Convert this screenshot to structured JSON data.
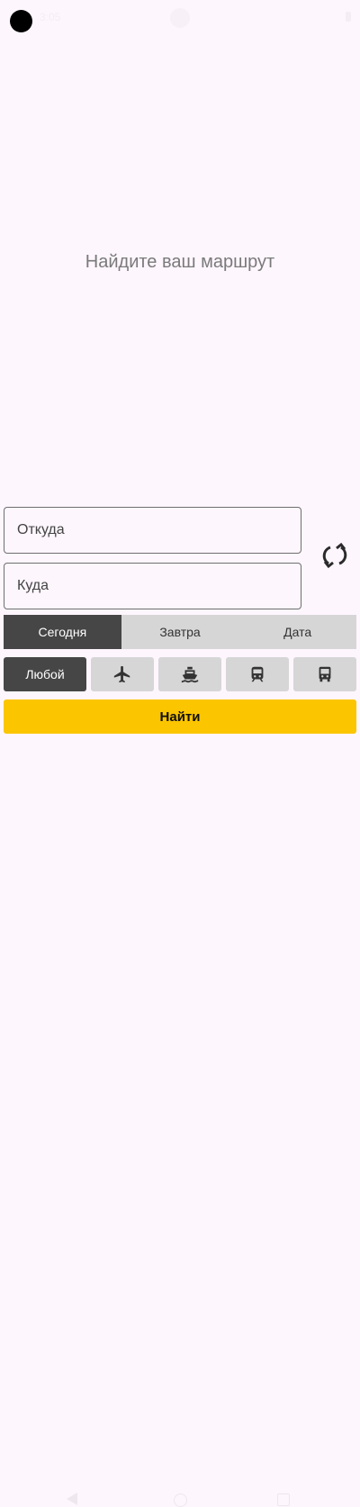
{
  "status": {
    "time": "3:05"
  },
  "hero": {
    "title": "Найдите ваш маршрут"
  },
  "form": {
    "from_placeholder": "Откуда",
    "to_placeholder": "Куда"
  },
  "date_tabs": [
    {
      "label": "Сегодня",
      "active": true
    },
    {
      "label": "Завтра",
      "active": false
    },
    {
      "label": "Дата",
      "active": false
    }
  ],
  "transport": {
    "any_label": "Любой",
    "icons": [
      "airplane-icon",
      "ship-icon",
      "train-icon",
      "bus-icon"
    ]
  },
  "search_button": {
    "label": "Найти"
  },
  "colors": {
    "accent": "#fbc500",
    "active_tab": "#464646",
    "inactive_tab": "#d6d6d6",
    "background": "#fdf6fd"
  }
}
